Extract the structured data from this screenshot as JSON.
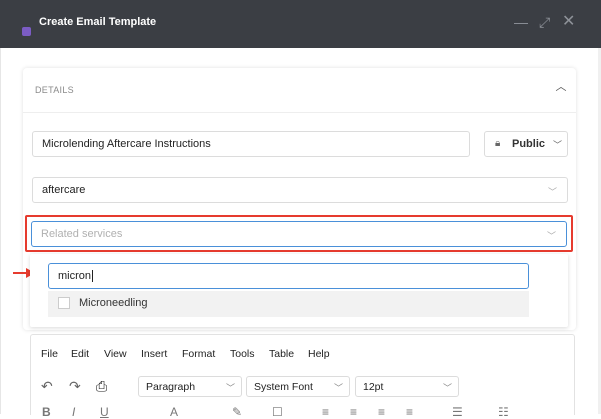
{
  "window": {
    "title": "Create Email Template",
    "controls": [
      "minimize-icon",
      "maximize-icon",
      "close-icon"
    ]
  },
  "details": {
    "section_label": "DETAILS",
    "name_value": "Microlending Aftercare Instructions",
    "visibility_value": "Public",
    "category_value": "aftercare",
    "related_services_placeholder": "Related services",
    "search_value": "micron",
    "options": [
      {
        "label": "Microneedling",
        "checked": false
      }
    ]
  },
  "editor": {
    "menu": [
      "File",
      "Edit",
      "View",
      "Insert",
      "Format",
      "Tools",
      "Table",
      "Help"
    ],
    "block_format": "Paragraph",
    "font_family": "System Font",
    "font_size": "12pt"
  },
  "colors": {
    "titlebar": "#3b3e44",
    "highlight": "#e63b2e",
    "focus_border": "#4a90d9"
  }
}
